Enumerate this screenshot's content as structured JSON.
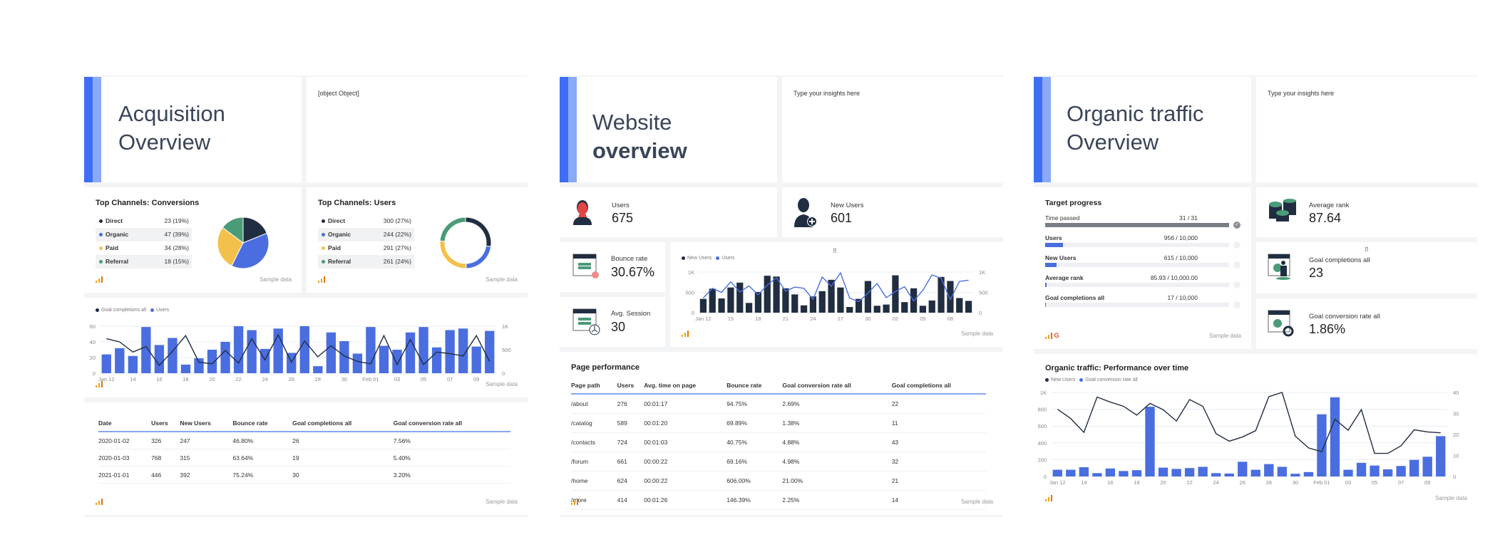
{
  "colors": {
    "accent": "#3d6ef5",
    "accent_light": "#8aaaf8",
    "dark": "#212d40",
    "blue": "#4a6ee0",
    "yellow": "#f3c14b",
    "green": "#4a9b78",
    "gray_bar": "#7a7f87"
  },
  "acquisition": {
    "title_line1": "Acquisition",
    "title_line2": "Overview",
    "note": "[object Object]",
    "conversions": {
      "title": "Top Channels: Conversions",
      "rows": [
        {
          "label": "Direct",
          "value": "23 (19%)"
        },
        {
          "label": "Organic",
          "value": "47 (39%)"
        },
        {
          "label": "Paid",
          "value": "34 (28%)"
        },
        {
          "label": "Referral",
          "value": "18 (15%)"
        }
      ],
      "sample": "Sample data"
    },
    "users": {
      "title": "Top Channels: Users",
      "rows": [
        {
          "label": "Direct",
          "value": "300 (27%)"
        },
        {
          "label": "Organic",
          "value": "244 (22%)"
        },
        {
          "label": "Paid",
          "value": "291 (27%)"
        },
        {
          "label": "Referral",
          "value": "261 (24%)"
        }
      ],
      "sample": "Sample data"
    },
    "combo_sample": "Sample data",
    "table": {
      "headers": [
        "Date",
        "Users",
        "New Users",
        "Bounce rate",
        "Goal completions all",
        "Goal conversion rate all"
      ],
      "rows": [
        [
          "2020-01-02",
          "326",
          "247",
          "46.80%",
          "26",
          "7.56%"
        ],
        [
          "2020-01-03",
          "768",
          "315",
          "63.64%",
          "19",
          "5.40%"
        ],
        [
          "2021-01-01",
          "446",
          "392",
          "75.24%",
          "30",
          "3.20%"
        ]
      ],
      "sample": "Sample data"
    }
  },
  "website": {
    "title_line1": "Website",
    "title_line2": "overview",
    "note": "Type your insights here",
    "kpis": {
      "users": {
        "label": "Users",
        "value": "675"
      },
      "new_users": {
        "label": "New Users",
        "value": "601"
      },
      "bounce": {
        "label": "Bounce rate",
        "value": "30.67%"
      },
      "session": {
        "label": "Avg. Session",
        "value": "30"
      }
    },
    "chart_sample": "Sample data",
    "table": {
      "title": "Page performance",
      "headers": [
        "Page path",
        "Users",
        "Avg. time on page",
        "Bounce rate",
        "Goal conversion rate all",
        "Goal completions all"
      ],
      "rows": [
        [
          "/about",
          "276",
          "00:01:17",
          "94.75%",
          "2.69%",
          "22"
        ],
        [
          "/catalog",
          "589",
          "00:01:20",
          "69.89%",
          "1.38%",
          "11"
        ],
        [
          "/contacts",
          "724",
          "00:01:03",
          "40.75%",
          "4.88%",
          "43"
        ],
        [
          "/forum",
          "661",
          "00:00:22",
          "69.16%",
          "4.98%",
          "32"
        ],
        [
          "/home",
          "624",
          "00:00:22",
          "606.00%",
          "21.00%",
          "21"
        ],
        [
          "/more",
          "414",
          "00:01:26",
          "146.39%",
          "2.25%",
          "14"
        ]
      ],
      "sample": "Sample data"
    }
  },
  "organic": {
    "title_line1": "Organic traffic",
    "title_line2": "Overview",
    "note": "Type your insights here",
    "progress": {
      "title": "Target progress",
      "items": [
        {
          "label": "Time passed",
          "value": "31 / 31",
          "fraction": 1.0,
          "done": true
        },
        {
          "label": "Users",
          "value": "956 / 10,000",
          "fraction": 0.0956
        },
        {
          "label": "New Users",
          "value": "615 / 10,000",
          "fraction": 0.0615
        },
        {
          "label": "Average rank",
          "value": "85.93 / 10,000.00",
          "fraction": 0.0086
        },
        {
          "label": "Goal completions all",
          "value": "17 / 10,000",
          "fraction": 0.0017
        }
      ],
      "sample": "Sample data"
    },
    "kpis": {
      "avg_rank": {
        "label": "Average rank",
        "value": "87.64"
      },
      "goal_completions": {
        "label": "Goal completions all",
        "value": "23"
      },
      "goal_conv": {
        "label": "Goal conversion rate all",
        "value": "1.86%"
      }
    },
    "chart_sample": "Sample data"
  },
  "chart_data": [
    {
      "id": "conversions_pie",
      "type": "pie",
      "title": "Top Channels: Conversions",
      "categories": [
        "Direct",
        "Organic",
        "Paid",
        "Referral"
      ],
      "values": [
        23,
        47,
        34,
        18
      ]
    },
    {
      "id": "users_donut",
      "type": "pie",
      "title": "Top Channels: Users",
      "categories": [
        "Direct",
        "Organic",
        "Paid",
        "Referral"
      ],
      "values": [
        300,
        244,
        291,
        261
      ]
    },
    {
      "id": "acq_combo",
      "type": "bar",
      "x": [
        "Jan 12",
        "13",
        "14",
        "15",
        "16",
        "17",
        "18",
        "19",
        "20",
        "21",
        "22",
        "23",
        "24",
        "25",
        "26",
        "27",
        "28",
        "29",
        "30",
        "31",
        "Feb 01",
        "02",
        "03",
        "04",
        "05",
        "06",
        "07",
        "08",
        "09",
        "10"
      ],
      "xticks": [
        "Jan 12",
        "14",
        "16",
        "18",
        "20",
        "22",
        "24",
        "26",
        "28",
        "30",
        "Feb 01",
        "03",
        "05",
        "07",
        "09"
      ],
      "legend": [
        "Goal completions all",
        "Users"
      ],
      "series": [
        {
          "name": "Users",
          "kind": "bar",
          "axis": "right",
          "values": [
            400,
            533,
            367,
            983,
            600,
            750,
            183,
            317,
            500,
            667,
            1000,
            917,
            517,
            950,
            433,
            1000,
            150,
            867,
            683,
            417,
            983,
            583,
            500,
            867,
            983,
            550,
            917,
            950,
            567,
            900
          ]
        },
        {
          "name": "Goal completions all",
          "kind": "line",
          "axis": "left",
          "values": [
            44,
            40,
            27,
            34,
            10,
            28,
            48,
            14,
            12,
            29,
            13,
            44,
            17,
            49,
            14,
            41,
            21,
            35,
            22,
            15,
            12,
            48,
            11,
            43,
            11,
            27,
            25,
            22,
            48,
            15
          ]
        }
      ],
      "ylim_left": [
        0,
        60
      ],
      "yticks_left": [
        "0",
        "20",
        "40",
        "60"
      ],
      "ylim_right": [
        0,
        1000
      ],
      "yticks_right": [
        "0",
        "500",
        "1K"
      ]
    },
    {
      "id": "web_combo",
      "type": "bar",
      "x": [
        "Jan 12",
        "13",
        "14",
        "15",
        "16",
        "17",
        "18",
        "19",
        "20",
        "21",
        "22",
        "23",
        "24",
        "25",
        "26",
        "27",
        "28",
        "29",
        "30",
        "31",
        "01",
        "02",
        "03",
        "04",
        "05",
        "06",
        "07",
        "08",
        "09",
        "10"
      ],
      "xticks": [
        "Jan 12",
        "15",
        "18",
        "21",
        "24",
        "27",
        "30",
        "02",
        "05",
        "08"
      ],
      "legend": [
        "New Users",
        "Users"
      ],
      "series": [
        {
          "name": "New Users",
          "kind": "bar",
          "axis": "left",
          "values": [
            340,
            590,
            350,
            620,
            740,
            240,
            510,
            910,
            890,
            600,
            450,
            180,
            400,
            530,
            810,
            620,
            140,
            340,
            780,
            170,
            200,
            920,
            260,
            600,
            170,
            300,
            880,
            780,
            360,
            290
          ]
        },
        {
          "name": "Users",
          "kind": "line",
          "axis": "right",
          "values": [
            360,
            600,
            500,
            760,
            510,
            660,
            440,
            680,
            860,
            530,
            630,
            600,
            330,
            880,
            650,
            980,
            360,
            270,
            480,
            720,
            370,
            520,
            640,
            290,
            550,
            930,
            850,
            320,
            770,
            800
          ]
        }
      ],
      "ylim_left": [
        0,
        1000
      ],
      "yticks_left": [
        "0",
        "500",
        "1K"
      ],
      "ylim_right": [
        0,
        1000
      ],
      "yticks_right": [
        "0",
        "500",
        "1K"
      ]
    },
    {
      "id": "org_combo",
      "type": "bar",
      "title": "Organic traffic: Performance over time",
      "x": [
        "Jan 12",
        "13",
        "14",
        "15",
        "16",
        "17",
        "18",
        "19",
        "20",
        "21",
        "22",
        "23",
        "24",
        "25",
        "26",
        "27",
        "28",
        "29",
        "30",
        "31",
        "Feb 01",
        "02",
        "03",
        "04",
        "05",
        "06",
        "07",
        "08",
        "09",
        "10"
      ],
      "xticks": [
        "Jan 12",
        "14",
        "16",
        "18",
        "20",
        "22",
        "24",
        "26",
        "28",
        "30",
        "Feb 01",
        "03",
        "05",
        "07",
        "09"
      ],
      "legend": [
        "New Users",
        "Goal conversion rate all"
      ],
      "series": [
        {
          "name": "Goal conversion rate all",
          "kind": "bar",
          "axis": "right",
          "values": [
            3.2,
            3.2,
            4.4,
            1.6,
            3.8,
            2.6,
            3.0,
            33.2,
            4.2,
            3.6,
            4.0,
            4.6,
            1.6,
            1.4,
            7.0,
            3.2,
            5.9,
            4.6,
            1.3,
            2.1,
            29.6,
            37.7,
            3.2,
            6.5,
            5.2,
            3.4,
            5.0,
            7.9,
            9.4,
            19.2
          ]
        },
        {
          "name": "New Users",
          "kind": "line",
          "axis": "left",
          "values": [
            800,
            690,
            525,
            945,
            885,
            835,
            730,
            870,
            795,
            660,
            915,
            835,
            510,
            420,
            470,
            545,
            950,
            1000,
            480,
            340,
            295,
            680,
            550,
            795,
            275,
            275,
            365,
            555,
            530,
            520
          ]
        }
      ],
      "ylim_left": [
        0,
        1000
      ],
      "yticks_left": [
        "0",
        "200",
        "400",
        "600",
        "800",
        "1K"
      ],
      "ylim_right": [
        0,
        40
      ],
      "yticks_right": [
        "0",
        "10",
        "20",
        "30",
        "40"
      ]
    }
  ]
}
